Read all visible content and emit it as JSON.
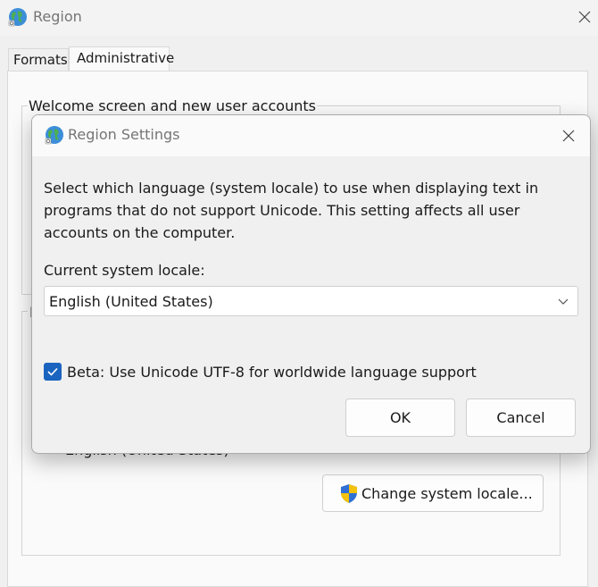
{
  "main_window": {
    "title": "Region",
    "close_icon": "close-icon",
    "tabs": [
      {
        "label": "Formats"
      },
      {
        "label": "Administrative"
      }
    ],
    "welcome_group": {
      "label": "Welcome screen and new user accounts"
    },
    "unicode_group": {
      "label": "L"
    },
    "current_locale_value": "English (United States)",
    "change_locale_button": {
      "label": "Change system locale...",
      "icon": "uac-shield-icon"
    }
  },
  "dialog": {
    "title": "Region Settings",
    "close_icon": "close-icon",
    "description": "Select which language (system locale) to use when displaying text in programs that do not support Unicode. This setting affects all user accounts on the computer.",
    "locale_label": "Current system locale:",
    "locale_select": {
      "value": "English (United States)"
    },
    "beta_checkbox": {
      "label": "Beta: Use Unicode UTF-8 for worldwide language support",
      "checked": true
    },
    "ok_label": "OK",
    "cancel_label": "Cancel"
  },
  "colors": {
    "checkbox_accent": "#1a64c0",
    "window_bg": "#f0f0f0"
  }
}
